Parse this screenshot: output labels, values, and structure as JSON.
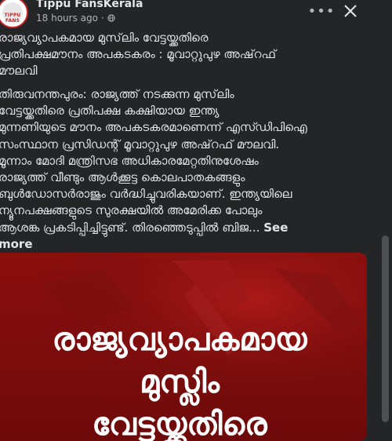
{
  "post": {
    "page_name": "Tippu FansKerala",
    "timestamp": "18 hours ago",
    "separator": "·",
    "avatar_text": "TIPPU FANS",
    "more_label": "•••",
    "title": "രാജ്യവ്യാപകമായ മുസ്‌ലിം വേട്ടയ്ക്കതിരെ\nപ്രതിപക്ഷമൗനം അപകടകരം : മൂവാറ്റുപുഴ അഷ്‌റഫ്\nമൗലവി",
    "body": "തിരുവനന്തപുരം: രാജ്യത്ത് നടക്കുന്ന മുസ്‌ലിം\nവേട്ടയ്ക്കതിരെ പ്രതിപക്ഷ കക്ഷിയായ ഇന്ത്യ\nമുന്നണിയുടെ മൗനം അപകടകരമാണെന്ന് എസ്ഡിപിഐ\nസംസ്ഥാന പ്രസിഡന്റ് മൂവാറ്റുപുഴ അഷ്‌റഫ് മൗലവി.\nമൂന്നാം മോദി മന്ത്രിസഭ അധികാരമേറ്റതിനുശേഷം\nരാജ്യത്ത് വീണ്ടും ആൾക്കൂട്ട കൊലപാതകങ്ങളും\nബുൾഡോസർരാജും വർദ്ധിച്ചുവരികയാണ്. ഇന്ത്യയിലെ\nന്യൂനപക്ഷങ്ങളുടെ സുരക്ഷയിൽ അമേരിക്ക പോലും\nആശങ്ക പ്രകടിപ്പിച്ചിട്ടുണ്ട്.  തിരഞ്ഞെടുപ്പിൽ ബിജ...",
    "see_more": "See\nmore"
  },
  "card": {
    "line1": "രാജ്യവ്യാപകമായ",
    "line2": "മുസ്ലിം",
    "line3": "വേട്ടയ്ക്കതിരെ"
  },
  "colors": {
    "background": "#242526",
    "text": "#e4e6eb",
    "secondary": "#b0b3b8",
    "card_red": "#8c0f0f"
  },
  "icons": {
    "privacy": "globe-icon",
    "more": "more-options-icon",
    "close": "close-icon"
  }
}
